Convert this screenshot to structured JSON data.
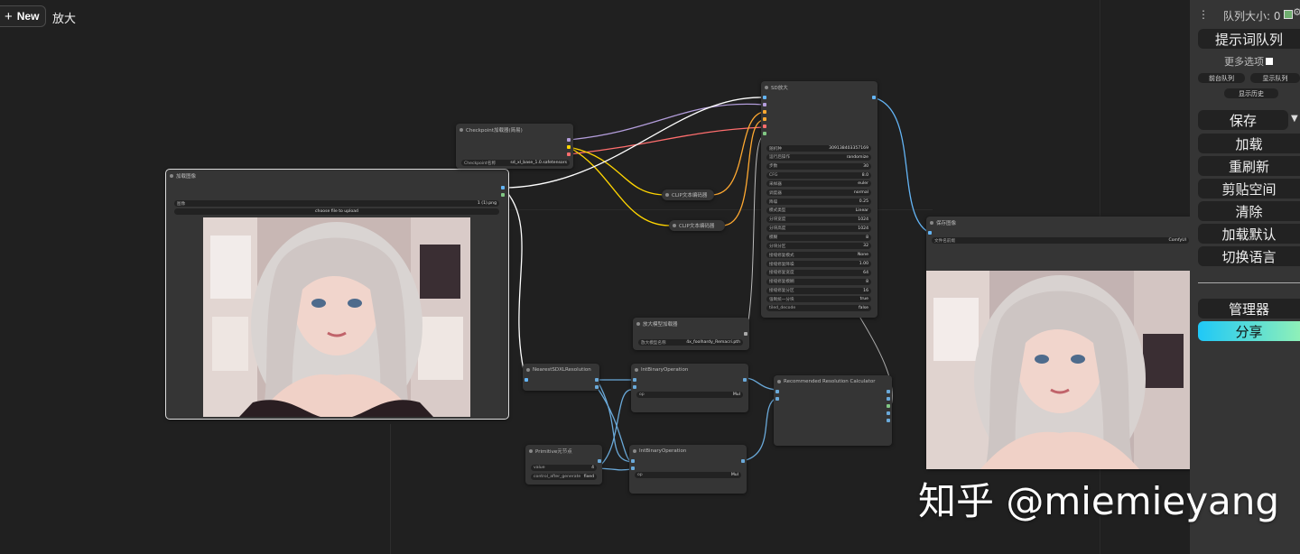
{
  "topbar": {
    "new_label": "New",
    "workflow_title": "放大"
  },
  "colors": {
    "canvas": "#202020",
    "node": "#353535",
    "model_wire": "#b39ddb",
    "clip_wire": "#ffd500",
    "vae_wire": "#ff6e6e",
    "image_wire": "#64b5f6",
    "latent_wire": "#ff9cf9",
    "conditioning_wire": "#ffa931",
    "accent": "#1fc8f7"
  },
  "nodes": {
    "load_image": {
      "title": "加载图像",
      "image_label": "图像",
      "image_value": "1 (1).png",
      "upload_label": "choose file to upload"
    },
    "checkpoint": {
      "title": "Checkpoint加载器(简易)",
      "ckpt_label": "Checkpoint名称",
      "ckpt_value": "sd_xl_base_1.0.safetensors"
    },
    "clip_pos": {
      "title": "CLIP文本编码器"
    },
    "clip_neg": {
      "title": "CLIP文本编码器"
    },
    "sd_upscale": {
      "title": "SD放大",
      "widgets": [
        {
          "label": "随机种",
          "value": "309138403357169"
        },
        {
          "label": "运行后操作",
          "value": "randomize"
        },
        {
          "label": "步数",
          "value": "30"
        },
        {
          "label": "CFG",
          "value": "8.0"
        },
        {
          "label": "采样器",
          "value": "euler"
        },
        {
          "label": "调度器",
          "value": "normal"
        },
        {
          "label": "降噪",
          "value": "0.25"
        },
        {
          "label": "模式类型",
          "value": "Linear"
        },
        {
          "label": "分块宽度",
          "value": "1024"
        },
        {
          "label": "分块高度",
          "value": "1024"
        },
        {
          "label": "模糊",
          "value": "8"
        },
        {
          "label": "分块分区",
          "value": "32"
        },
        {
          "label": "接缝修复模式",
          "value": "None"
        },
        {
          "label": "接缝修复降噪",
          "value": "1.00"
        },
        {
          "label": "接缝修复宽度",
          "value": "64"
        },
        {
          "label": "接缝修复模糊",
          "value": "8"
        },
        {
          "label": "接缝修复分区",
          "value": "16"
        },
        {
          "label": "强制统一分块",
          "value": "true"
        },
        {
          "label": "tiled_decode",
          "value": "false"
        }
      ]
    },
    "save_image": {
      "title": "保存图像",
      "prefix_label": "文件名前缀",
      "prefix_value": "ComfyUI"
    },
    "upscale_model": {
      "title": "放大模型加载器",
      "model_label": "放大模型名称",
      "model_value": "4x_foolhardy_Remacri.pth"
    },
    "nearest_sdxl": {
      "title": "NearestSDXLResolution"
    },
    "int_op1": {
      "title": "IntBinaryOperation",
      "op_label": "op",
      "op_value": "Mul"
    },
    "int_op2": {
      "title": "IntBinaryOperation",
      "op_label": "op",
      "op_value": "Mul"
    },
    "rec_res": {
      "title": "Recommended Resolution Calculator"
    },
    "primitive": {
      "title": "Primitive元节点",
      "value_label": "value",
      "value_value": "4",
      "control_label": "control_after_generate",
      "control_value": "fixed"
    }
  },
  "sidebar": {
    "queue_size_label": "队列大小: 0",
    "queue_prompt": "提示词队列",
    "extra_options": "更多选项",
    "queue_front": "前台队列",
    "view_queue": "显示队列",
    "view_history": "显示历史",
    "save": "保存",
    "load": "加载",
    "refresh": "重刷新",
    "clipspace": "剪贴空间",
    "clear": "清除",
    "load_default": "加载默认",
    "switch_locale": "切换语言",
    "manager": "管理器",
    "share": "分享"
  },
  "watermark": "知乎 @miemieyang"
}
